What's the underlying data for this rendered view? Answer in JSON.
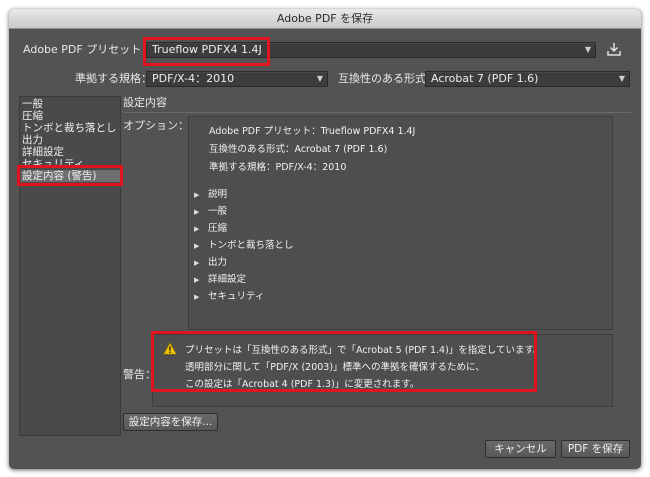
{
  "window": {
    "title": "Adobe PDF を保存"
  },
  "preset": {
    "label": "Adobe PDF プリセット：",
    "value": "Trueflow PDFX4 1.4J"
  },
  "standard": {
    "label": "準拠する規格：",
    "value": "PDF/X-4：2010"
  },
  "compat": {
    "label": "互換性のある形式：",
    "value": "Acrobat 7 (PDF 1.6)"
  },
  "sidebar": {
    "items": [
      {
        "label": "一般"
      },
      {
        "label": "圧縮"
      },
      {
        "label": "トンボと裁ち落とし"
      },
      {
        "label": "出力"
      },
      {
        "label": "詳細設定"
      },
      {
        "label": "セキュリティ"
      },
      {
        "label": "設定内容 (警告)"
      }
    ]
  },
  "main": {
    "section_title": "設定内容",
    "options_label": "オプション：",
    "summary": [
      "Adobe PDF プリセット：Trueflow PDFX4 1.4J",
      "互換性のある形式：Acrobat 7 (PDF 1.6)",
      "準拠する規格：PDF/X-4：2010"
    ],
    "tree": [
      {
        "label": "説明"
      },
      {
        "label": "一般"
      },
      {
        "label": "圧縮"
      },
      {
        "label": "トンボと裁ち落とし"
      },
      {
        "label": "出力"
      },
      {
        "label": "詳細設定"
      },
      {
        "label": "セキュリティ"
      }
    ],
    "warning_label": "警告：",
    "warning_lines": [
      "プリセットは「互換性のある形式」で「Acrobat 5 (PDF 1.4)」を指定しています。",
      "透明部分に関して「PDF/X (2003)」標準への準拠を確保するために、",
      "この設定は「Acrobat 4 (PDF 1.3)」に変更されます。"
    ],
    "save_summary_button": "設定内容を保存..."
  },
  "footer": {
    "cancel_button": "キャンセル",
    "save_button": "PDF を保存"
  },
  "colors": {
    "highlight": "#e0141e",
    "window_bg": "#535353",
    "warning": "#f2c400"
  }
}
